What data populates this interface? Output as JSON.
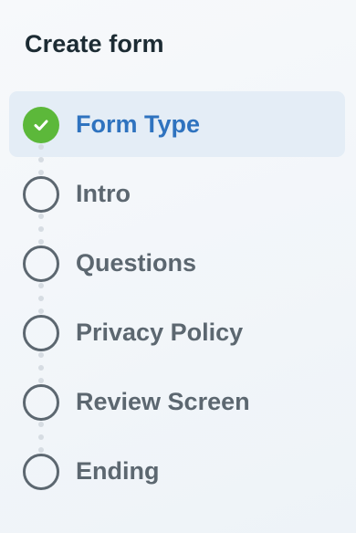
{
  "form": {
    "title": "Create form",
    "steps": [
      {
        "label": "Form Type",
        "status": "completed",
        "active": true
      },
      {
        "label": "Intro",
        "status": "pending",
        "active": false
      },
      {
        "label": "Questions",
        "status": "pending",
        "active": false
      },
      {
        "label": "Privacy Policy",
        "status": "pending",
        "active": false
      },
      {
        "label": "Review Screen",
        "status": "pending",
        "active": false
      },
      {
        "label": "Ending",
        "status": "pending",
        "active": false
      }
    ]
  },
  "colors": {
    "active_text": "#2f73bf",
    "active_background": "#e4edf6",
    "completed_check": "#5cb83a",
    "pending": "#5c6770",
    "title": "#1c2b33"
  },
  "icons": {
    "completed": "check-circle-icon",
    "pending": "empty-circle-icon"
  }
}
